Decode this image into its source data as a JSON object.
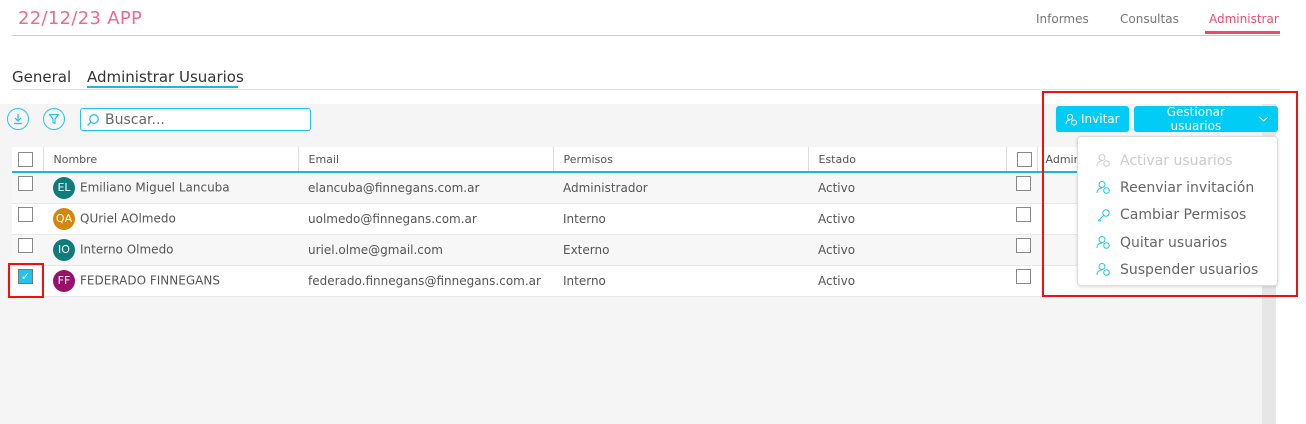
{
  "app": {
    "title": "22/12/23 APP"
  },
  "nav": [
    {
      "label": "Informes"
    },
    {
      "label": "Consultas"
    },
    {
      "label": "Administrar"
    }
  ],
  "tabs": [
    {
      "label": "General"
    },
    {
      "label": "Administrar Usuarios"
    }
  ],
  "toolbar": {
    "search_placeholder": "Buscar...",
    "invite_label": "Invitar",
    "manage_label": "Gestionar usuarios"
  },
  "table": {
    "headers": [
      "Nombre",
      "Email",
      "Permisos",
      "Estado",
      "Admin"
    ],
    "rows": [
      {
        "initials": "EL",
        "color": "#0e7c7b",
        "name": "Emiliano Miguel Lancuba",
        "email": "elancuba@finnegans.com.ar",
        "permisos": "Administrador",
        "estado": "Activo",
        "checked": false
      },
      {
        "initials": "QA",
        "color": "#d4870c",
        "name": "QUriel AOlmedo",
        "email": "uolmedo@finnegans.com.ar",
        "permisos": "Interno",
        "estado": "Activo",
        "checked": false
      },
      {
        "initials": "IO",
        "color": "#0e7c7b",
        "name": "Interno Olmedo",
        "email": "uriel.olme@gmail.com",
        "permisos": "Externo",
        "estado": "Activo",
        "checked": false
      },
      {
        "initials": "FF",
        "color": "#9b0f6a",
        "name": "FEDERADO FINNEGANS",
        "email": "federado.finnegans@finnegans.com.ar",
        "permisos": "Interno",
        "estado": "Activo",
        "checked": true
      }
    ]
  },
  "menu": [
    {
      "label": "Activar usuarios",
      "disabled": true
    },
    {
      "label": "Reenviar invitación"
    },
    {
      "label": "Cambiar Permisos"
    },
    {
      "label": "Quitar usuarios"
    },
    {
      "label": "Suspender usuarios"
    }
  ],
  "colors": {
    "accent": "#00ccf5",
    "brand": "#f06a8a",
    "highlight": "#f01010"
  }
}
